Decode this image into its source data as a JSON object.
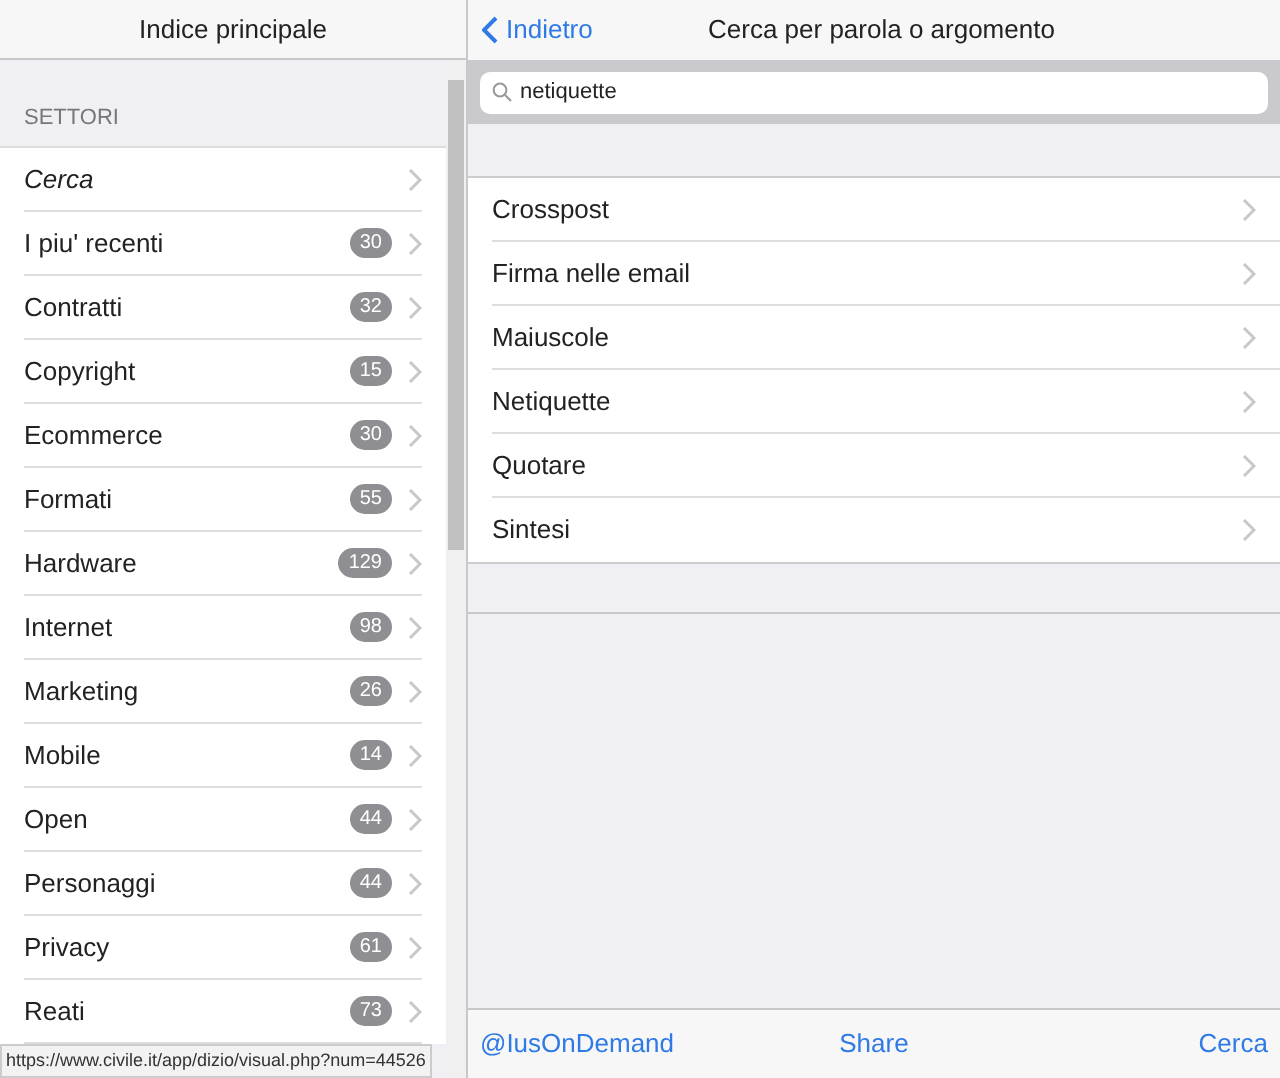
{
  "sidebar": {
    "title": "Indice principale",
    "section": "SETTORI",
    "items": [
      {
        "label": "Cerca",
        "kind": "search"
      },
      {
        "label": "I piu' recenti",
        "count": "30",
        "kind": "category"
      },
      {
        "label": "Contratti",
        "count": "32",
        "kind": "category"
      },
      {
        "label": "Copyright",
        "count": "15",
        "kind": "category"
      },
      {
        "label": "Ecommerce",
        "count": "30",
        "kind": "category"
      },
      {
        "label": "Formati",
        "count": "55",
        "kind": "category"
      },
      {
        "label": "Hardware",
        "count": "129",
        "kind": "category"
      },
      {
        "label": "Internet",
        "count": "98",
        "kind": "category"
      },
      {
        "label": "Marketing",
        "count": "26",
        "kind": "category"
      },
      {
        "label": "Mobile",
        "count": "14",
        "kind": "category"
      },
      {
        "label": "Open",
        "count": "44",
        "kind": "category"
      },
      {
        "label": "Personaggi",
        "count": "44",
        "kind": "category"
      },
      {
        "label": "Privacy",
        "count": "61",
        "kind": "category"
      },
      {
        "label": "Reati",
        "count": "73",
        "kind": "category"
      }
    ]
  },
  "status_bar": "https://www.civile.it/app/dizio/visual.php?num=44526",
  "main": {
    "back": "Indietro",
    "title": "Cerca per parola o argomento",
    "search": {
      "value": "netiquette"
    },
    "results": [
      "Crosspost",
      "Firma nelle email",
      "Maiuscole",
      "Netiquette",
      "Quotare",
      "Sintesi"
    ]
  },
  "toolbar": [
    "@IusOnDemand",
    "Share",
    "Cerca"
  ]
}
